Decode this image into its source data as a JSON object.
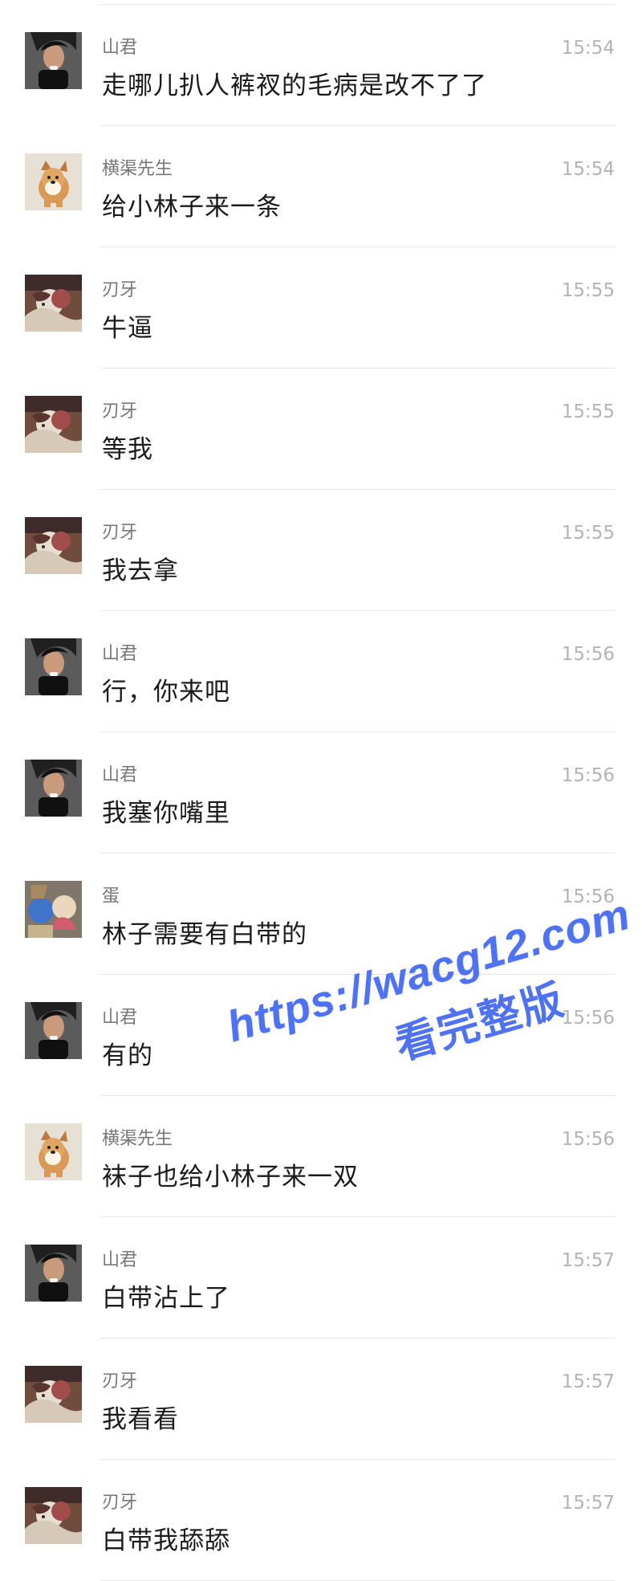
{
  "messages": [
    {
      "sender": "山君",
      "time": "15:54",
      "text": "走哪儿扒人裤衩的毛病是改不了了",
      "avatar": "shanjun"
    },
    {
      "sender": "横渠先生",
      "time": "15:54",
      "text": "给小林子来一条",
      "avatar": "dog"
    },
    {
      "sender": "刃牙",
      "time": "15:55",
      "text": "牛逼",
      "avatar": "renya"
    },
    {
      "sender": "刃牙",
      "time": "15:55",
      "text": "等我",
      "avatar": "renya"
    },
    {
      "sender": "刃牙",
      "time": "15:55",
      "text": "我去拿",
      "avatar": "renya"
    },
    {
      "sender": "山君",
      "time": "15:56",
      "text": "行，你来吧",
      "avatar": "shanjun"
    },
    {
      "sender": "山君",
      "time": "15:56",
      "text": "我塞你嘴里",
      "avatar": "shanjun"
    },
    {
      "sender": "蛋",
      "time": "15:56",
      "text": "林子需要有白带的",
      "avatar": "dan"
    },
    {
      "sender": "山君",
      "time": "15:56",
      "text": "有的",
      "avatar": "shanjun"
    },
    {
      "sender": "横渠先生",
      "time": "15:56",
      "text": "袜子也给小林子来一双",
      "avatar": "dog"
    },
    {
      "sender": "山君",
      "time": "15:57",
      "text": "白带沾上了",
      "avatar": "shanjun"
    },
    {
      "sender": "刃牙",
      "time": "15:57",
      "text": "我看看",
      "avatar": "renya"
    },
    {
      "sender": "刃牙",
      "time": "15:57",
      "text": "白带我舔舔",
      "avatar": "renya"
    }
  ],
  "watermark": {
    "url": "https://wacg12.com",
    "subtitle": "看完整版",
    "color": "#4f72f5"
  }
}
